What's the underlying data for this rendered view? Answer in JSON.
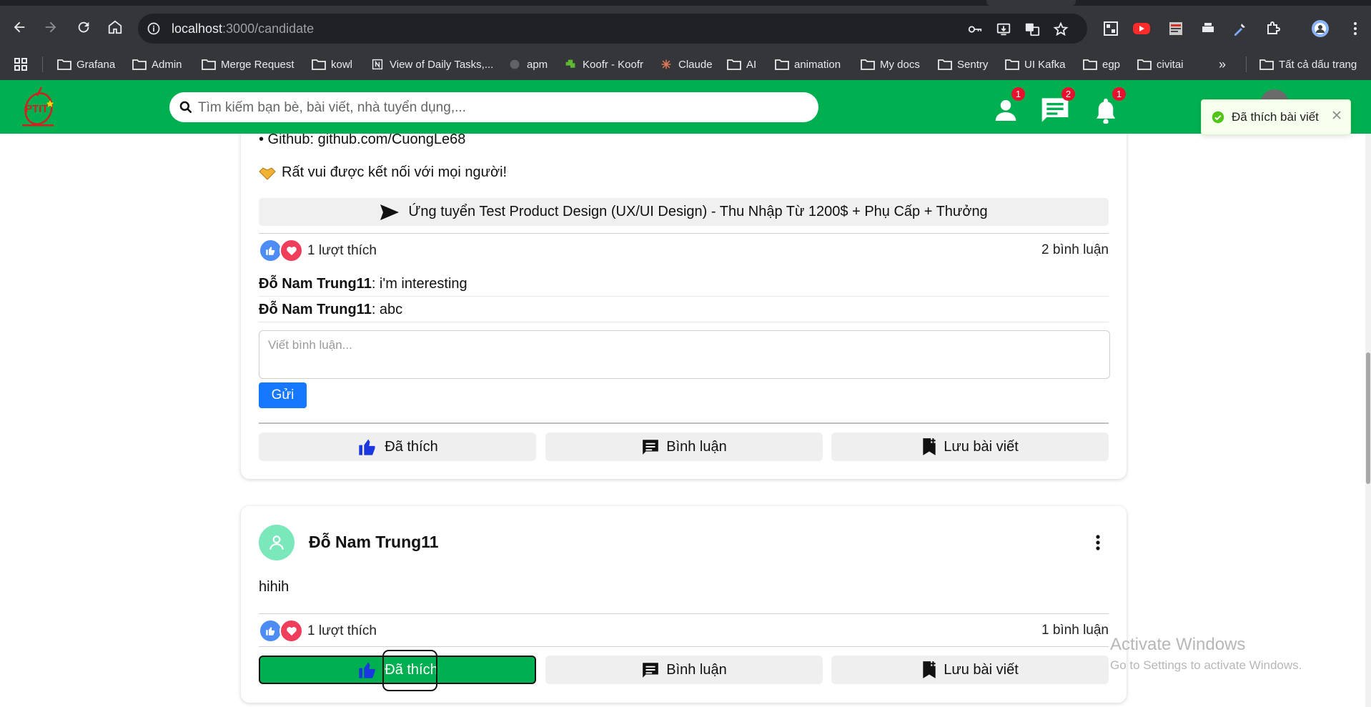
{
  "browser": {
    "url_host": "localhost",
    "url_rest": ":3000/candidate",
    "bookmarks": [
      "Grafana",
      "Admin",
      "Merge Request",
      "kowl",
      "View of Daily Tasks,...",
      "apm",
      "Koofr - Koofr",
      "Claude",
      "AI",
      "animation",
      "My docs",
      "Sentry",
      "UI Kafka",
      "egp",
      "civitai"
    ],
    "bookmarks_overflow": "»",
    "all_bookmarks": "Tất cả dấu trang"
  },
  "app": {
    "logo_text": "PTIT",
    "search_placeholder": "Tìm kiếm bạn bè, bài viết, nhà tuyển dụng,...",
    "badges": {
      "friends": "1",
      "messages": "2",
      "notifications": "1"
    },
    "toast": "Đã thích bài viết",
    "colors": {
      "primary": "#00b050",
      "badge": "#e8112d",
      "send_button": "#1677ff"
    }
  },
  "post1": {
    "github_line": "• Github: github.com/CuongLe68",
    "closing_line": "Rất vui được kết nối với mọi người!",
    "apply_button": "Ứng tuyển Test Product Design (UX/UI Design) - Thu Nhập Từ 1200$ + Phụ Cấp + Thưởng",
    "likes": "1 lượt thích",
    "comments_count": "2 bình luận",
    "comments": [
      {
        "author": "Đỗ Nam Trung11",
        "text": ": i'm interesting"
      },
      {
        "author": "Đỗ Nam Trung11",
        "text": ": abc"
      }
    ],
    "comment_placeholder": "Viết bình luận...",
    "send_button": "Gửi",
    "actions": {
      "like": "Đã thích",
      "comment": "Bình luận",
      "save": "Lưu bài viết"
    }
  },
  "post2": {
    "author": "Đỗ Nam Trung11",
    "content": "hihih",
    "likes": "1 lượt thích",
    "comments_count": "1 bình luận",
    "actions": {
      "like": "Đã thích",
      "comment": "Bình luận",
      "save": "Lưu bài viết"
    }
  },
  "watermark": {
    "line1": "Activate Windows",
    "line2": "Go to Settings to activate Windows."
  }
}
